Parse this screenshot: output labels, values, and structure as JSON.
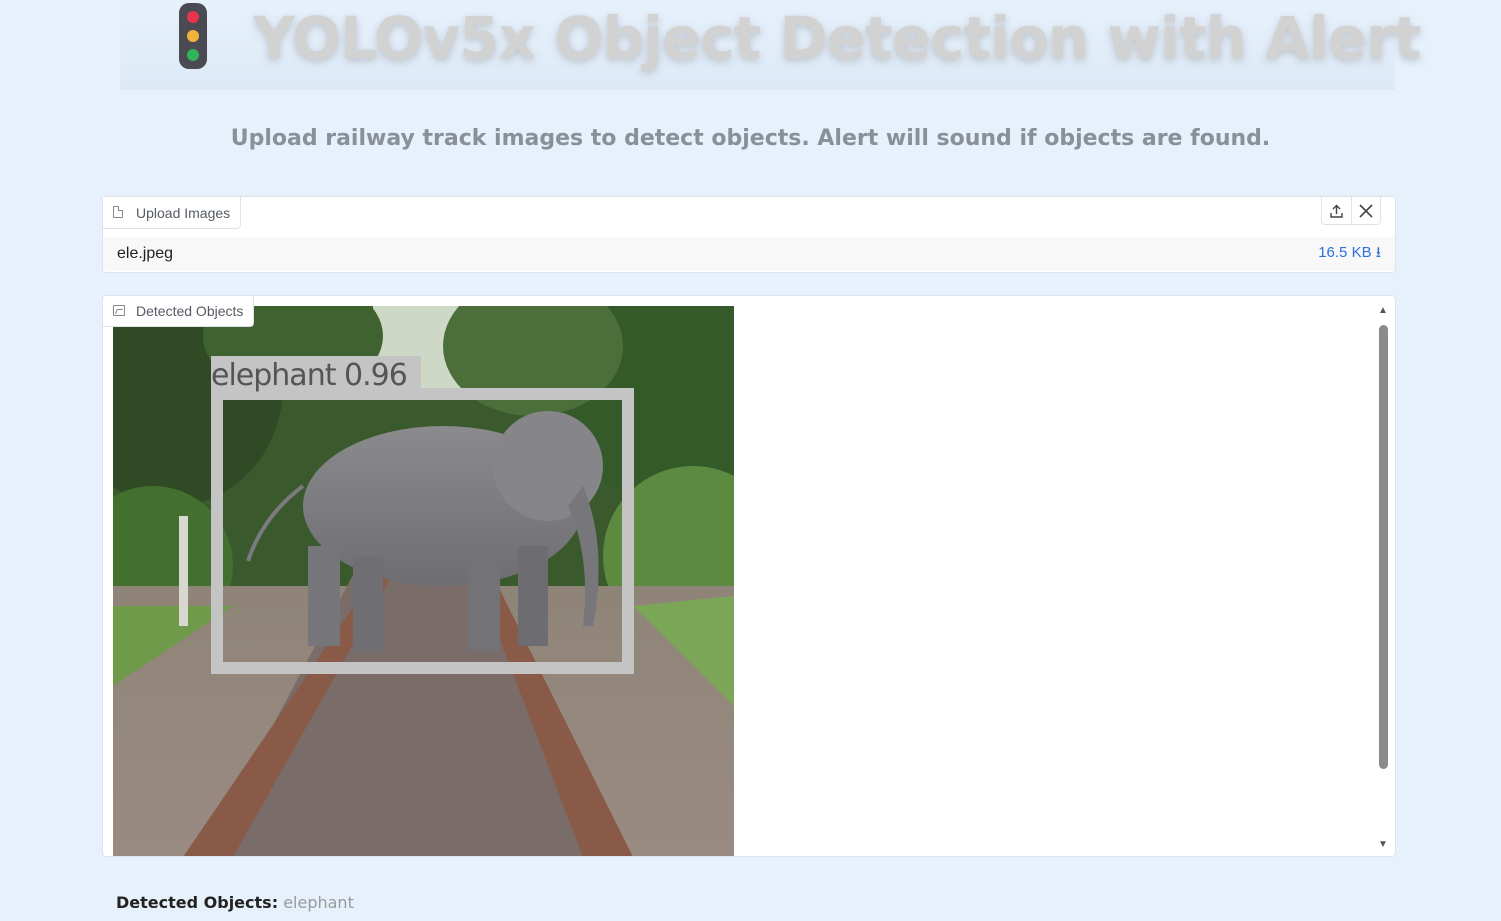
{
  "header": {
    "title": "YOLOv5x Object Detection with Alert",
    "subtitle": "Upload railway track images to detect objects. Alert will sound if objects are found.",
    "icon": "traffic-light-icon"
  },
  "upload": {
    "label": "Upload Images",
    "file_name": "ele.jpeg",
    "file_size": "16.5 KB ⭳",
    "icons": [
      "file-icon",
      "upload-icon",
      "close-icon"
    ]
  },
  "output": {
    "label": "Detected Objects",
    "detection_label": "elephant 0.96",
    "icons": [
      "image-icon"
    ]
  },
  "result": {
    "label": "Detected Objects:",
    "value": "elephant"
  },
  "colors": {
    "background": "#e6f1fc",
    "link": "#2f6fd6",
    "bbox": "#c4c4c4"
  }
}
